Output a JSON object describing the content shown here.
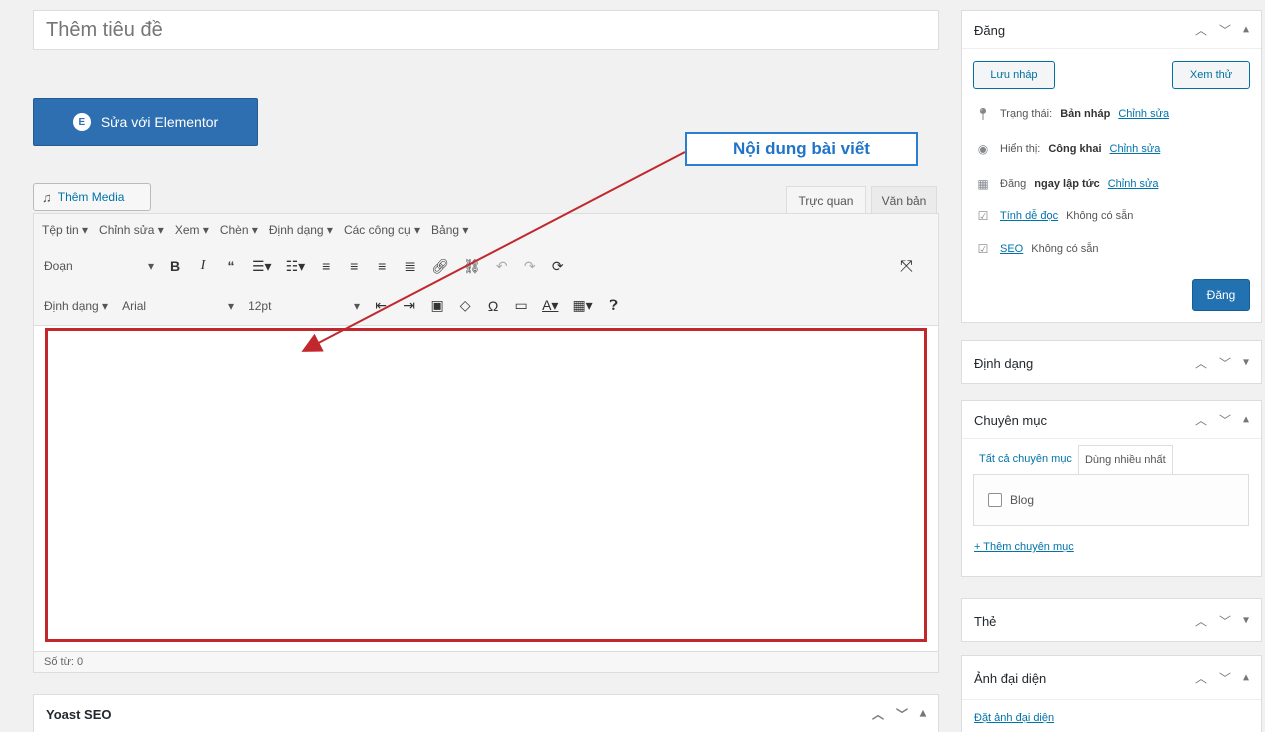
{
  "post": {
    "title_placeholder": "Thêm tiêu đề",
    "elementor_button": "Sửa với Elementor",
    "add_media": "Thêm Media",
    "tabs": {
      "visual": "Trực quan",
      "text": "Văn bản"
    },
    "menubar": [
      "Tệp tin ▾",
      "Chỉnh sửa ▾",
      "Xem ▾",
      "Chèn ▾",
      "Định dạng ▾",
      "Các công cụ ▾",
      "Bảng ▾"
    ],
    "toolbar1": {
      "format_select": "Đoạn"
    },
    "toolbar2": {
      "format_menu": "Định dạng ▾",
      "font_select": "Arial",
      "size_select": "12pt"
    },
    "word_count": "Số từ: 0",
    "annotation": "Nội dung bài viết"
  },
  "yoast": {
    "title": "Yoast SEO"
  },
  "publish": {
    "title": "Đăng",
    "save_draft": "Lưu nháp",
    "preview": "Xem thử",
    "status_label": "Trạng thái:",
    "status_value": "Bản nháp",
    "visibility_label": "Hiển thị:",
    "visibility_value": "Công khai",
    "schedule_label": "Đăng",
    "schedule_value": "ngay lập tức",
    "edit_link": "Chỉnh sửa",
    "readability_label": "Tính dễ đọc",
    "readability_value": "Không có sẵn",
    "seo_label": "SEO",
    "seo_value": "Không có sẵn",
    "publish_button": "Đăng"
  },
  "format_box": {
    "title": "Định dạng"
  },
  "category_box": {
    "title": "Chuyên mục",
    "tab_all": "Tất cả chuyên mục",
    "tab_popular": "Dùng nhiều nhất",
    "items": [
      "Blog"
    ],
    "add_link": "+ Thêm chuyên mục"
  },
  "tag_box": {
    "title": "Thẻ"
  },
  "thumbnail_box": {
    "title": "Ảnh đại diện",
    "set_link": "Đặt ảnh đại diện"
  },
  "colors": {
    "primary": "#2271b1",
    "elementor": "#2d6fb0",
    "highlight": "#c1272d",
    "annotation": "#1f74c8"
  }
}
